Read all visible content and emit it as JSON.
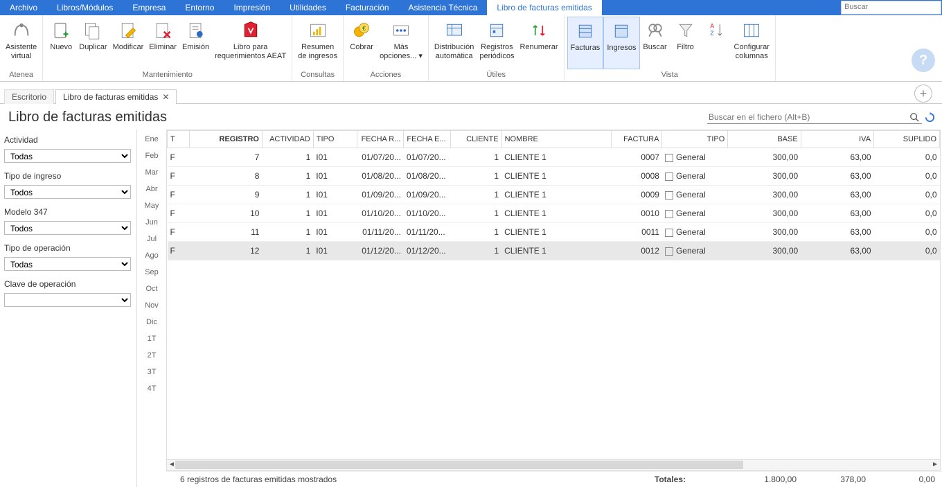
{
  "menu": {
    "items": [
      "Archivo",
      "Libros/Módulos",
      "Empresa",
      "Entorno",
      "Impresión",
      "Utilidades",
      "Facturación",
      "Asistencia Técnica",
      "Libro de facturas emitidas"
    ],
    "active_index": 8,
    "search_placeholder": "Buscar"
  },
  "ribbon": {
    "groups": [
      {
        "label": "Atenea",
        "buttons": [
          {
            "name": "asistente-virtual",
            "label": "Asistente\nvirtual"
          }
        ]
      },
      {
        "label": "Mantenimiento",
        "buttons": [
          {
            "name": "nuevo",
            "label": "Nuevo"
          },
          {
            "name": "duplicar",
            "label": "Duplicar"
          },
          {
            "name": "modificar",
            "label": "Modificar"
          },
          {
            "name": "eliminar",
            "label": "Eliminar"
          },
          {
            "name": "emision",
            "label": "Emisión"
          },
          {
            "name": "libro-req",
            "label": "Libro para\nrequerimientos AEAT"
          }
        ]
      },
      {
        "label": "Consultas",
        "buttons": [
          {
            "name": "resumen-ingresos",
            "label": "Resumen\nde ingresos"
          }
        ]
      },
      {
        "label": "Acciones",
        "buttons": [
          {
            "name": "cobrar",
            "label": "Cobrar"
          },
          {
            "name": "mas-opciones",
            "label": "Más\nopciones... ▾"
          }
        ]
      },
      {
        "label": "Útiles",
        "buttons": [
          {
            "name": "distribucion",
            "label": "Distribución\nautomática"
          },
          {
            "name": "registros-periodicos",
            "label": "Registros\nperiódicos"
          },
          {
            "name": "renumerar",
            "label": "Renumerar"
          }
        ]
      },
      {
        "label": "Vista",
        "buttons": [
          {
            "name": "facturas",
            "label": "Facturas",
            "active": true
          },
          {
            "name": "ingresos",
            "label": "Ingresos",
            "active": true
          },
          {
            "name": "buscar",
            "label": "Buscar"
          },
          {
            "name": "filtro",
            "label": "Filtro"
          },
          {
            "name": "orden",
            "label": ""
          },
          {
            "name": "configurar-columnas",
            "label": "Configurar\ncolumnas"
          }
        ]
      }
    ]
  },
  "tabs": [
    {
      "label": "Escritorio",
      "closable": false
    },
    {
      "label": "Libro de facturas emitidas",
      "closable": true,
      "active": true
    }
  ],
  "page_title": "Libro de facturas emitidas",
  "file_search_placeholder": "Buscar en el fichero (Alt+B)",
  "filters": [
    {
      "label": "Actividad",
      "value": "Todas"
    },
    {
      "label": "Tipo de ingreso",
      "value": "Todos"
    },
    {
      "label": "Modelo 347",
      "value": "Todos"
    },
    {
      "label": "Tipo de operación",
      "value": "Todas"
    },
    {
      "label": "Clave de operación",
      "value": ""
    }
  ],
  "months": [
    "Ene",
    "Feb",
    "Mar",
    "Abr",
    "May",
    "Jun",
    "Jul",
    "Ago",
    "Sep",
    "Oct",
    "Nov",
    "Dic",
    "1T",
    "2T",
    "3T",
    "4T"
  ],
  "table": {
    "columns": [
      "T",
      "REGISTRO",
      "ACTIVIDAD",
      "TIPO",
      "FECHA R...",
      "FECHA E...",
      "CLIENTE",
      "NOMBRE",
      "FACTURA",
      "TIPO",
      "BASE",
      "IVA",
      "SUPLIDO"
    ],
    "sorted_col": 1,
    "rows": [
      {
        "t": "F",
        "registro": "7",
        "actividad": "1",
        "tipo": "I01",
        "fr": "01/07/20...",
        "fe": "01/07/20...",
        "cliente": "1",
        "nombre": "CLIENTE 1",
        "factura": "0007",
        "tipo2": "General",
        "base": "300,00",
        "iva": "63,00",
        "suplido": "0,0"
      },
      {
        "t": "F",
        "registro": "8",
        "actividad": "1",
        "tipo": "I01",
        "fr": "01/08/20...",
        "fe": "01/08/20...",
        "cliente": "1",
        "nombre": "CLIENTE 1",
        "factura": "0008",
        "tipo2": "General",
        "base": "300,00",
        "iva": "63,00",
        "suplido": "0,0"
      },
      {
        "t": "F",
        "registro": "9",
        "actividad": "1",
        "tipo": "I01",
        "fr": "01/09/20...",
        "fe": "01/09/20...",
        "cliente": "1",
        "nombre": "CLIENTE 1",
        "factura": "0009",
        "tipo2": "General",
        "base": "300,00",
        "iva": "63,00",
        "suplido": "0,0"
      },
      {
        "t": "F",
        "registro": "10",
        "actividad": "1",
        "tipo": "I01",
        "fr": "01/10/20...",
        "fe": "01/10/20...",
        "cliente": "1",
        "nombre": "CLIENTE 1",
        "factura": "0010",
        "tipo2": "General",
        "base": "300,00",
        "iva": "63,00",
        "suplido": "0,0"
      },
      {
        "t": "F",
        "registro": "11",
        "actividad": "1",
        "tipo": "I01",
        "fr": "01/11/20...",
        "fe": "01/11/20...",
        "cliente": "1",
        "nombre": "CLIENTE 1",
        "factura": "0011",
        "tipo2": "General",
        "base": "300,00",
        "iva": "63,00",
        "suplido": "0,0"
      },
      {
        "t": "F",
        "registro": "12",
        "actividad": "1",
        "tipo": "I01",
        "fr": "01/12/20...",
        "fe": "01/12/20...",
        "cliente": "1",
        "nombre": "CLIENTE 1",
        "factura": "0012",
        "tipo2": "General",
        "base": "300,00",
        "iva": "63,00",
        "suplido": "0,0",
        "selected": true
      }
    ]
  },
  "footer": {
    "status": "6 registros de facturas emitidas mostrados",
    "totals_label": "Totales:",
    "base": "1.800,00",
    "iva": "378,00",
    "suplido": "0,00"
  }
}
